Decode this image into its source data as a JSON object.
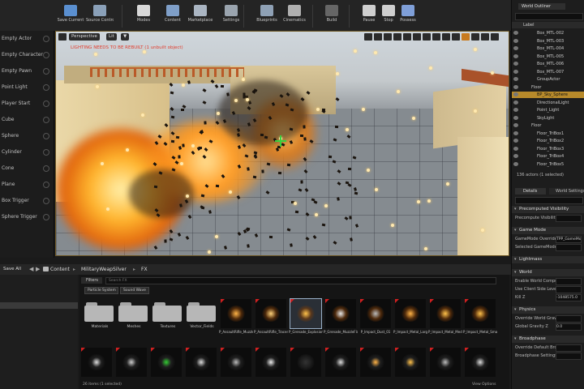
{
  "toolbar": {
    "items": [
      {
        "label": "Save Current",
        "icon": "save-icon"
      },
      {
        "label": "Source Control",
        "icon": "source-control-icon"
      },
      {
        "label": "Modes",
        "icon": "modes-icon"
      },
      {
        "label": "Content",
        "icon": "content-icon"
      },
      {
        "label": "Marketplace",
        "icon": "marketplace-icon"
      },
      {
        "label": "Settings",
        "icon": "settings-icon"
      },
      {
        "label": "Blueprints",
        "icon": "blueprints-icon"
      },
      {
        "label": "Cinematics",
        "icon": "cinematics-icon"
      },
      {
        "label": "Build",
        "icon": "build-icon"
      },
      {
        "label": "Pause",
        "icon": "pause-icon"
      },
      {
        "label": "Stop",
        "icon": "stop-icon"
      },
      {
        "label": "Possess",
        "icon": "possess-icon"
      }
    ]
  },
  "left_panel": {
    "items": [
      "Empty Actor",
      "Empty Character",
      "Empty Pawn",
      "Point Light",
      "Player Start",
      "Cube",
      "Sphere",
      "Cylinder",
      "Cone",
      "Plane",
      "Box Trigger",
      "Sphere Trigger"
    ]
  },
  "viewport": {
    "perspective_label": "Perspective",
    "lit_label": "Lit",
    "warning": "LIGHTING NEEDS TO BE REBUILT (1 unbuilt object)"
  },
  "outliner": {
    "title": "World Outliner",
    "column_label": "Label",
    "rows": [
      {
        "text": "Box_MTL-002",
        "indent": 3
      },
      {
        "text": "Box_MTL-003",
        "indent": 3
      },
      {
        "text": "Box_MTL-004",
        "indent": 3
      },
      {
        "text": "Box_MTL-005",
        "indent": 3
      },
      {
        "text": "Box_MTL-006",
        "indent": 3
      },
      {
        "text": "Box_MTL-007",
        "indent": 3
      },
      {
        "text": "GroupActor",
        "indent": 3
      },
      {
        "text": "Floor",
        "indent": 2
      },
      {
        "text": "BP_Sky_Sphere",
        "indent": 3
      },
      {
        "text": "DirectionalLight",
        "indent": 3
      },
      {
        "text": "Point_Light",
        "indent": 3
      },
      {
        "text": "SkyLight",
        "indent": 3
      },
      {
        "text": "Floor",
        "indent": 2
      },
      {
        "text": "Floor_TriBox1",
        "indent": 3
      },
      {
        "text": "Floor_TriBox2",
        "indent": 3
      },
      {
        "text": "Floor_TriBox3",
        "indent": 3
      },
      {
        "text": "Floor_TriBox4",
        "indent": 3
      },
      {
        "text": "Floor_TriBox5",
        "indent": 3
      }
    ],
    "footer": "136 actors (1 selected)"
  },
  "details": {
    "tabs": [
      "Details",
      "World Settings"
    ],
    "sections": [
      {
        "title": "Precomputed Visibility",
        "props": [
          {
            "label": "Precompute Visibility",
            "value": ""
          }
        ]
      },
      {
        "title": "Game Mode",
        "props": [
          {
            "label": "GameMode Override",
            "value": "TPP_GameMode"
          },
          {
            "label": "Selected GameMode",
            "value": ""
          }
        ]
      },
      {
        "title": "Lightmass",
        "props": []
      },
      {
        "title": "World",
        "props": [
          {
            "label": "Enable World Composition",
            "value": ""
          },
          {
            "label": "Use Client Side Level",
            "value": ""
          },
          {
            "label": "Kill Z",
            "value": "-1048575.0"
          }
        ]
      },
      {
        "title": "Physics",
        "props": [
          {
            "label": "Override World Gravity",
            "value": ""
          },
          {
            "label": "Global Gravity Z",
            "value": "0.0"
          }
        ]
      },
      {
        "title": "Broadphase",
        "props": [
          {
            "label": "Override Default Broad",
            "value": ""
          },
          {
            "label": "Broadphase Settings",
            "value": ""
          }
        ]
      }
    ]
  },
  "content_browser": {
    "add_all_label": "Save All",
    "breadcrumb": [
      "Content",
      "MilitaryWeapSilver",
      "FX"
    ],
    "filters_label": "Filters",
    "search_placeholder": "Search FX",
    "filter_chips": [
      "Particle System",
      "Sound Wave"
    ],
    "folders": [
      "Materials",
      "Meshes",
      "Textures",
      "Vector_Fields"
    ],
    "assets_row1": [
      "P_AssaultRifle_MuzzleFlash",
      "P_AssaultRifle_Tracer_01",
      "P_Grenade_Explosion_01",
      "P_Grenade_MuzzleFlash_01",
      "P_Impact_Dust_01",
      "P_Impact_Metal_Large_01",
      "P_Impact_Metal_Medium_01",
      "P_Impact_Metal_Small_01"
    ],
    "assets_row2_count": 12,
    "status": "26 items (1 selected)",
    "view_options": "View Options"
  }
}
